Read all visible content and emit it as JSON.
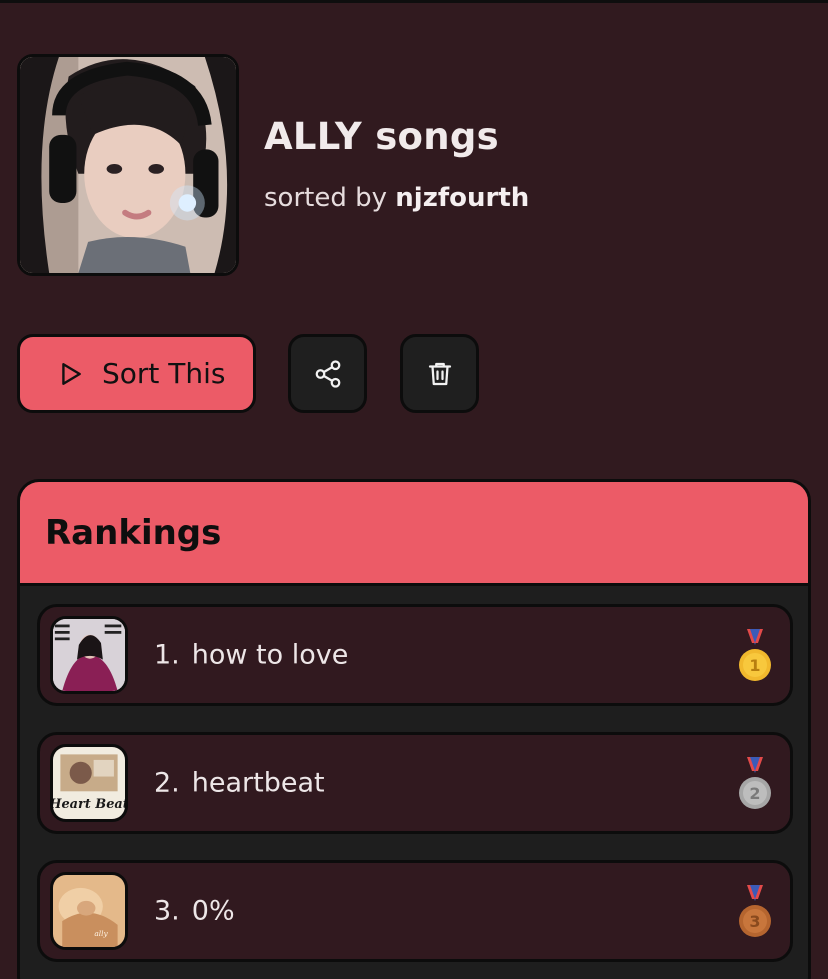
{
  "header": {
    "title": "ALLY songs",
    "sorted_by_prefix": "sorted by",
    "sorted_by_user": "njzfourth"
  },
  "actions": {
    "sort_label": "Sort This",
    "share_icon": "share-icon",
    "delete_icon": "trash-icon"
  },
  "rankings": {
    "title": "Rankings",
    "items": [
      {
        "rank": "1.",
        "title": "how to love",
        "medal": "gold-medal-icon",
        "medal_number": "1"
      },
      {
        "rank": "2.",
        "title": "heartbeat",
        "medal": "silver-medal-icon",
        "medal_number": "2"
      },
      {
        "rank": "3.",
        "title": "0%",
        "medal": "bronze-medal-icon",
        "medal_number": "3"
      }
    ]
  },
  "colors": {
    "background": "#311a1f",
    "accent": "#ec5b67",
    "panel": "#1e1e1e",
    "row": "#31191f"
  }
}
